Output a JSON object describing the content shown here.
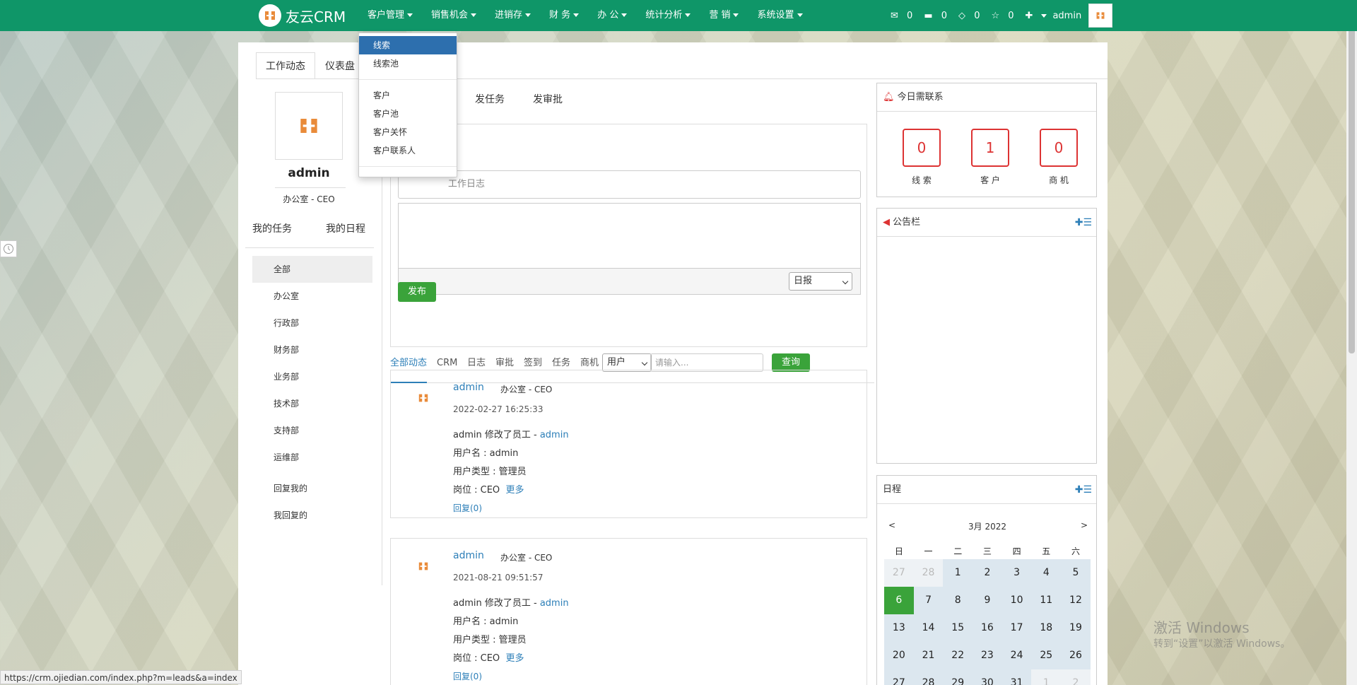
{
  "nav": {
    "brand": "友云CRM",
    "menu": [
      "客户管理",
      "销售机会",
      "进销存",
      "财 务",
      "办 公",
      "统计分析",
      "营 销",
      "系统设置"
    ],
    "right": {
      "mail": "0",
      "msg": "0",
      "task": "0",
      "star": "0",
      "user": "admin"
    }
  },
  "dropdown": {
    "group1": [
      "线索",
      "线索池"
    ],
    "group2": [
      "客户",
      "客户池",
      "客户关怀",
      "客户联系人"
    ]
  },
  "tabs": [
    "工作动态",
    "仪表盘"
  ],
  "profile": {
    "name": "admin",
    "role": "办公室 - CEO",
    "links": [
      "我的任务",
      "我的日程"
    ]
  },
  "depts": [
    "全部",
    "办公室",
    "行政部",
    "财务部",
    "业务部",
    "技术部",
    "支持部",
    "运维部"
  ],
  "replies": [
    "回复我的",
    "我回复的"
  ],
  "compose": {
    "tabs": [
      "发任务",
      "发审批"
    ],
    "title_placeholder": "工作日志",
    "type": "日报",
    "publish": "发布"
  },
  "filter": {
    "tabs": [
      "全部动态",
      "CRM",
      "日志",
      "审批",
      "签到",
      "任务",
      "商机"
    ],
    "select": "用户",
    "placeholder": "请输入...",
    "search": "查询"
  },
  "feeds": [
    {
      "user": "admin",
      "dept": "办公室 - CEO",
      "time": "2022-02-27 16:25:33",
      "action": "admin 修改了员工 - ",
      "target": "admin",
      "l1": "用户名 : admin",
      "l2": "用户类型 : 管理员",
      "l3": "岗位 : CEO",
      "more": "更多",
      "reply": "回复(0)"
    },
    {
      "user": "admin",
      "dept": "办公室 - CEO",
      "time": "2021-08-21 09:51:57",
      "action": "admin 修改了员工 - ",
      "target": "admin",
      "l1": "用户名 : admin",
      "l2": "用户类型 : 管理员",
      "l3": "岗位 : CEO",
      "more": "更多",
      "reply": "回复(0)"
    }
  ],
  "contact": {
    "title": "今日需联系",
    "items": [
      {
        "n": "0",
        "l": "线 索"
      },
      {
        "n": "1",
        "l": "客 户"
      },
      {
        "n": "0",
        "l": "商 机"
      }
    ]
  },
  "notice": {
    "title": "公告栏"
  },
  "schedule": {
    "title": "日程",
    "month": "3月 2022",
    "prev": "<",
    "next": ">",
    "weekdays": [
      "日",
      "一",
      "二",
      "三",
      "四",
      "五",
      "六"
    ],
    "rows": [
      [
        "27",
        "28",
        "1",
        "2",
        "3",
        "4",
        "5"
      ],
      [
        "6",
        "7",
        "8",
        "9",
        "10",
        "11",
        "12"
      ],
      [
        "13",
        "14",
        "15",
        "16",
        "17",
        "18",
        "19"
      ],
      [
        "20",
        "21",
        "22",
        "23",
        "24",
        "25",
        "26"
      ],
      [
        "27",
        "28",
        "29",
        "30",
        "31",
        "1",
        "2"
      ]
    ]
  },
  "watermark": {
    "l1": "激活 Windows",
    "l2": "转到“设置”以激活 Windows。"
  },
  "status_url": "https://crm.ojiedian.com/index.php?m=leads&a=index",
  "colors": {
    "brand": "#0f9668",
    "accent": "#2d7fb8",
    "green_btn": "#3aa33a",
    "alert": "#d33"
  }
}
